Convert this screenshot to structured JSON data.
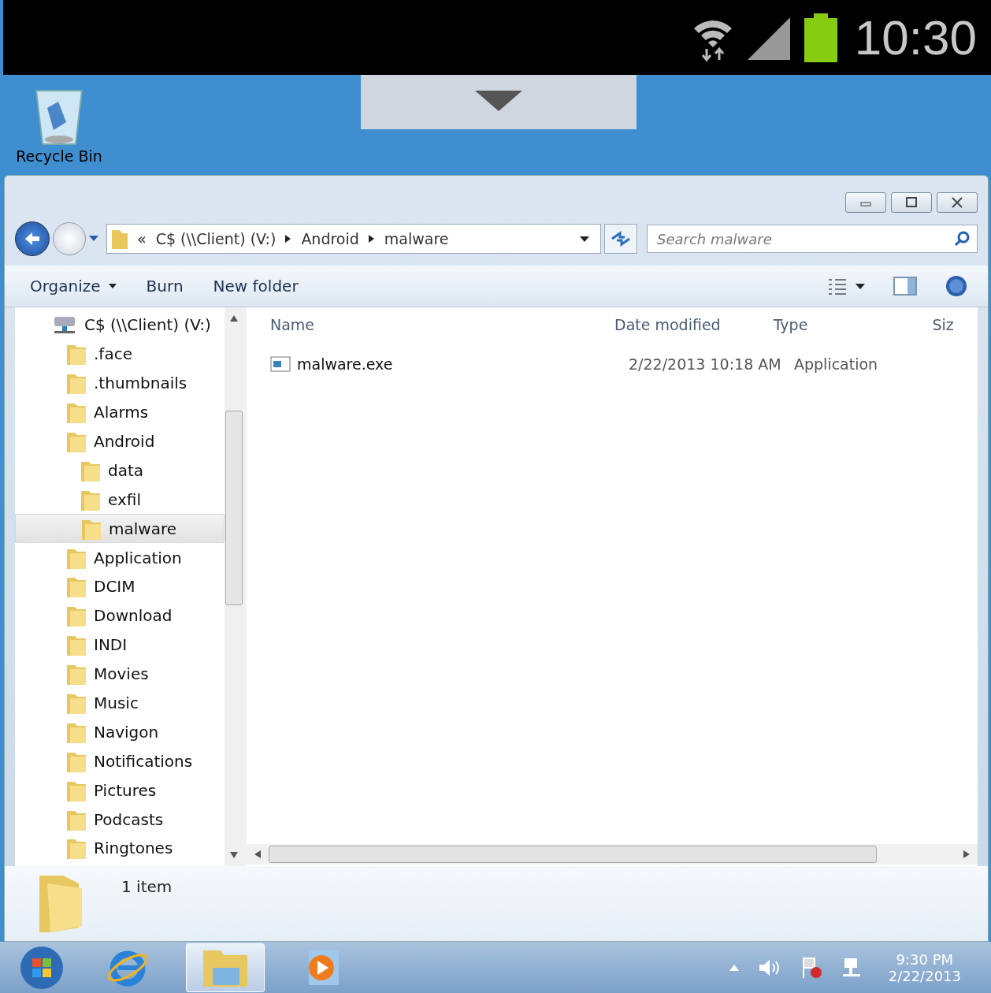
{
  "phone_status_bar": {
    "time": "10:30"
  },
  "desktop": {
    "icons": [
      {
        "label": "Recycle Bin"
      }
    ]
  },
  "window": {
    "address_bar": {
      "overflow": "«",
      "crumbs": [
        "C$ (\\\\Client) (V:)",
        "Android",
        "malware"
      ]
    },
    "search": {
      "placeholder": "Search malware"
    },
    "toolbar": [
      {
        "label": "Organize",
        "dropdown": true
      },
      {
        "label": "Burn",
        "dropdown": false
      },
      {
        "label": "New folder",
        "dropdown": false
      }
    ],
    "nav_tree": {
      "label": "C$ (\\\\Client) (V:)",
      "kind": "drive",
      "selected": false,
      "children": [
        {
          "label": ".face",
          "kind": "folder",
          "selected": false
        },
        {
          "label": ".thumbnails",
          "kind": "folder",
          "selected": false
        },
        {
          "label": "Alarms",
          "kind": "folder",
          "selected": false
        },
        {
          "label": "Android",
          "kind": "folder",
          "selected": false,
          "children": [
            {
              "label": "data",
              "kind": "folder",
              "selected": false
            },
            {
              "label": "exfil",
              "kind": "folder",
              "selected": false
            },
            {
              "label": "malware",
              "kind": "folder",
              "selected": true
            }
          ]
        },
        {
          "label": "Application",
          "kind": "folder",
          "selected": false
        },
        {
          "label": "DCIM",
          "kind": "folder",
          "selected": false
        },
        {
          "label": "Download",
          "kind": "folder",
          "selected": false
        },
        {
          "label": "INDI",
          "kind": "folder",
          "selected": false
        },
        {
          "label": "Movies",
          "kind": "folder",
          "selected": false
        },
        {
          "label": "Music",
          "kind": "folder",
          "selected": false
        },
        {
          "label": "Navigon",
          "kind": "folder",
          "selected": false
        },
        {
          "label": "Notifications",
          "kind": "folder",
          "selected": false
        },
        {
          "label": "Pictures",
          "kind": "folder",
          "selected": false
        },
        {
          "label": "Podcasts",
          "kind": "folder",
          "selected": false
        },
        {
          "label": "Ringtones",
          "kind": "folder",
          "selected": false
        }
      ]
    },
    "table": {
      "columns": [
        "Name",
        "Date modified",
        "Type",
        "Siz"
      ],
      "rows": [
        {
          "name": "malware.exe",
          "date_modified": "2/22/2013 10:18 AM",
          "type": "Application"
        }
      ]
    },
    "status_bar": {
      "count": "1 item"
    }
  },
  "taskbar": {
    "items": [
      {
        "kind": "start",
        "selected": false
      },
      {
        "kind": "browser",
        "selected": false
      },
      {
        "kind": "explorer",
        "selected": true
      },
      {
        "kind": "media",
        "selected": false
      }
    ],
    "clock": {
      "time": "9:30 PM",
      "date": "2/22/2013"
    }
  }
}
